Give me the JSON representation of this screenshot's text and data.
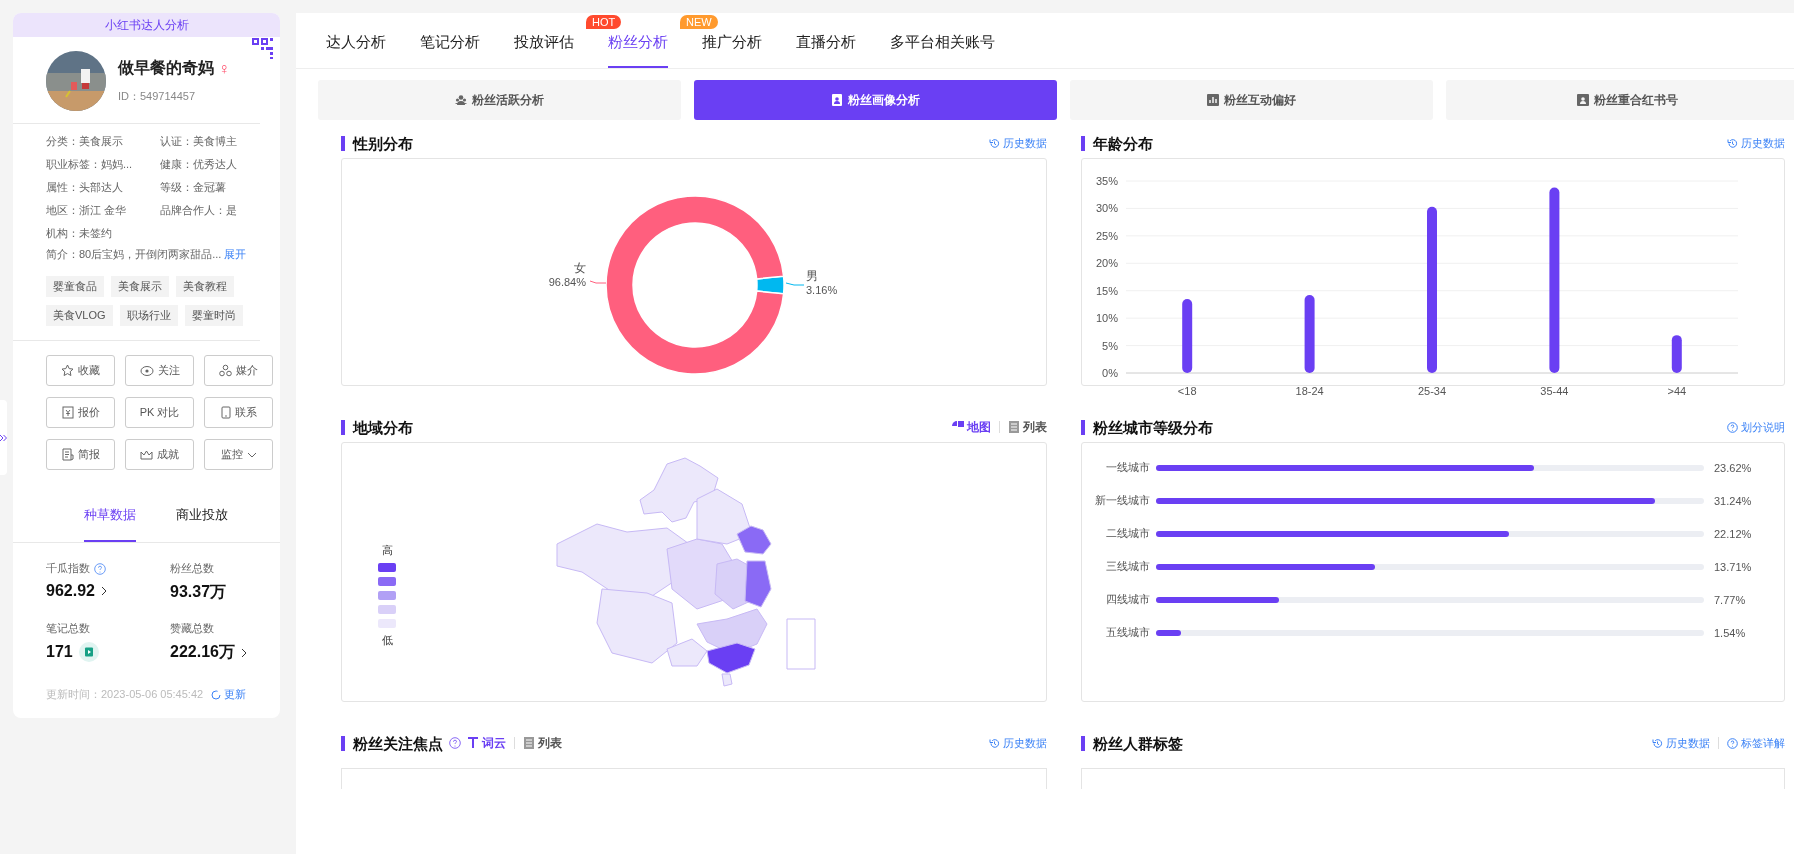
{
  "sidebar": {
    "header": "小红书达人分析",
    "name": "做早餐的奇妈",
    "gender_symbol": "♀",
    "id": "ID：549714457",
    "info": [
      "分类：美食展示",
      "认证：美食博主",
      "职业标签：妈妈...",
      "健康：优秀达人",
      "属性：头部达人",
      "等级：金冠薯",
      "地区：浙江 金华",
      "品牌合作人：是",
      "机构：未签约"
    ],
    "intro": "简介：80后宝妈，开倒闭两家甜品...",
    "expand": "展开",
    "tags": [
      "婴童食品",
      "美食展示",
      "美食教程",
      "美食VLOG",
      "职场行业",
      "婴童时尚"
    ],
    "buttons": [
      "收藏",
      "关注",
      "媒介",
      "报价",
      "PK 对比",
      "联系",
      "简报",
      "成就",
      "监控"
    ],
    "tabs": [
      {
        "label": "种草数据",
        "selected": true
      },
      {
        "label": "商业投放",
        "selected": false
      }
    ],
    "stats": [
      {
        "label": "千瓜指数",
        "value": "962.92",
        "kind": "index"
      },
      {
        "label": "粉丝总数",
        "value": "93.37万",
        "kind": "plain"
      },
      {
        "label": "笔记总数",
        "value": "171",
        "kind": "notes"
      },
      {
        "label": "赞藏总数",
        "value": "222.16万",
        "kind": "link"
      }
    ],
    "update_time": "更新时间：2023-05-06 05:45:42",
    "update_link": "更新"
  },
  "nav_tabs": [
    {
      "label": "达人分析",
      "selected": false
    },
    {
      "label": "笔记分析",
      "selected": false
    },
    {
      "label": "投放评估",
      "selected": false
    },
    {
      "label": "粉丝分析",
      "selected": true,
      "badge": "HOT",
      "color": "#ff4a2e"
    },
    {
      "label": "推广分析",
      "selected": false,
      "badge": "NEW",
      "color": "#ff9a2e"
    },
    {
      "label": "直播分析",
      "selected": false
    },
    {
      "label": "多平台相关账号",
      "selected": false
    }
  ],
  "sub_tabs": [
    {
      "label": "粉丝活跃分析",
      "selected": false
    },
    {
      "label": "粉丝画像分析",
      "selected": true
    },
    {
      "label": "粉丝互动偏好",
      "selected": false
    },
    {
      "label": "粉丝重合红书号",
      "selected": false
    }
  ],
  "gender": {
    "title": "性别分布",
    "link": "历史数据",
    "chart_data": {
      "type": "donut",
      "categories": [
        "女",
        "男"
      ],
      "values": [
        96.84,
        3.16
      ],
      "colors": [
        "#ff5f7e",
        "#00b8f0"
      ],
      "value_labels": [
        "96.84%",
        "3.16%"
      ]
    }
  },
  "age": {
    "title": "年龄分布",
    "link": "历史数据",
    "chart_data": {
      "type": "bar",
      "categories": [
        "<18",
        "18-24",
        "25-34",
        "35-44",
        ">44"
      ],
      "values": [
        13.5,
        14.2,
        30.3,
        33.8,
        6.9
      ],
      "color": "#6a3ff3",
      "grid": true,
      "ylim": [
        0,
        35
      ],
      "yticks": [
        {
          "value": 0,
          "label": "0%"
        },
        {
          "value": 5,
          "label": "5%"
        },
        {
          "value": 10,
          "label": "10%"
        },
        {
          "value": 15,
          "label": "15%"
        },
        {
          "value": 20,
          "label": "20%"
        },
        {
          "value": 25,
          "label": "25%"
        },
        {
          "value": 30,
          "label": "30%"
        },
        {
          "value": 35,
          "label": "35%"
        }
      ]
    }
  },
  "region": {
    "title": "地域分布",
    "views": [
      {
        "label": "地图",
        "selected": true
      },
      {
        "label": "列表",
        "selected": false
      }
    ],
    "legend_high": "高",
    "legend_low": "低"
  },
  "city": {
    "title": "粉丝城市等级分布",
    "link": "划分说明",
    "rows": [
      {
        "name": "一线城市",
        "level": 0.69,
        "value": "23.62%"
      },
      {
        "name": "新一线城市",
        "level": 0.91,
        "value": "31.24%"
      },
      {
        "name": "二线城市",
        "level": 0.645,
        "value": "22.12%"
      },
      {
        "name": "三线城市",
        "level": 0.4,
        "value": "13.71%"
      },
      {
        "name": "四线城市",
        "level": 0.225,
        "value": "7.77%"
      },
      {
        "name": "五线城市",
        "level": 0.045,
        "value": "1.54%"
      }
    ]
  },
  "focus": {
    "title": "粉丝关注焦点",
    "views": [
      {
        "label": "词云",
        "selected": true
      },
      {
        "label": "列表",
        "selected": false
      }
    ],
    "link": "历史数据"
  },
  "crowd": {
    "title": "粉丝人群标签",
    "links": [
      "历史数据",
      "标签详解"
    ]
  }
}
